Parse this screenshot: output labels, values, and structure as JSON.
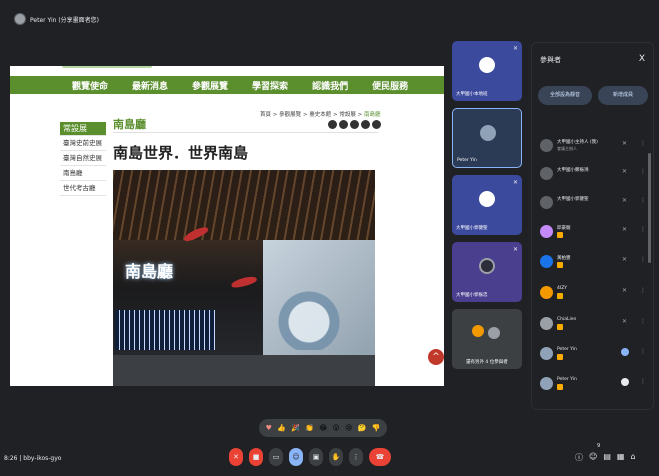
{
  "meeting": {
    "presenter_label": "Peter Yin (分享畫面者您)",
    "time_code": "8:26 | bby-ikos-gyo"
  },
  "website": {
    "nav": [
      "觀覽使命",
      "最新消息",
      "參觀展覽",
      "學習探索",
      "認識我們",
      "便民服務"
    ],
    "side_menu": [
      "常設展",
      "臺灣史前史展",
      "臺灣自然史展",
      "南島廳",
      "世代考古廳"
    ],
    "breadcrumb": "首頁 > 參觀展覽 > 臺史本館 > 常設展 >",
    "breadcrumb_current": "南島廳",
    "hall_title": "南島廳",
    "heading": "南島世界．世界南島",
    "photo_sign": "南島廳",
    "scroll_top": "^"
  },
  "tiles": [
    {
      "name": "大甲國小本地班",
      "mic": "✕",
      "selected": false
    },
    {
      "name": "Peter Yin",
      "mic": "",
      "selected": true
    },
    {
      "name": "大甲國小郭健聖",
      "mic": "✕",
      "selected": false
    },
    {
      "name": "大甲國小郭振忠",
      "mic": "✕",
      "selected": false
    },
    {
      "name": "還有另外 4 位參與者",
      "mic": "",
      "selected": false
    }
  ],
  "panel": {
    "title": "參與者",
    "close": "X",
    "mute_all": "全部設為靜音",
    "add_people": "新增成員",
    "participants": [
      {
        "name": "大甲國小主持人 (我)",
        "sub": "會議主辦人",
        "badge": false,
        "speaking": false
      },
      {
        "name": "大甲國小鄭振鴻",
        "sub": "",
        "badge": false,
        "speaking": false
      },
      {
        "name": "大甲國小郭健聖",
        "sub": "",
        "badge": false,
        "speaking": false
      },
      {
        "name": "邱豪駿",
        "sub": "",
        "badge": true,
        "speaking": false
      },
      {
        "name": "黃柏豐",
        "sub": "",
        "badge": true,
        "speaking": false
      },
      {
        "name": "4IZY",
        "sub": "",
        "badge": true,
        "speaking": false
      },
      {
        "name": "ChiaLien",
        "sub": "",
        "badge": true,
        "speaking": false
      },
      {
        "name": "Peter Yin",
        "sub": "",
        "badge": true,
        "speaking": true
      },
      {
        "name": "Peter Yin",
        "sub": "",
        "badge": true,
        "speaking": false
      }
    ]
  },
  "reactions": [
    "♥",
    "👍",
    "🎉",
    "👏",
    "😂",
    "😮",
    "😢",
    "🤔",
    "👎"
  ],
  "controls": {
    "people_count": "9"
  },
  "colors": {
    "accent_green": "#5b8f2e",
    "meet_bg": "#202124",
    "tile_blue": "#3c4a9e",
    "end_red": "#ea4335"
  }
}
